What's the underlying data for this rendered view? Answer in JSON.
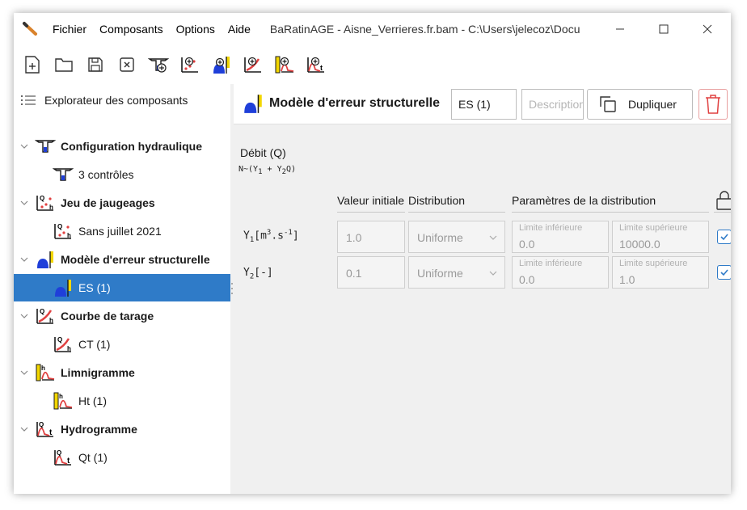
{
  "menu": [
    "Fichier",
    "Composants",
    "Options",
    "Aide"
  ],
  "window_title": "BaRatinAGE - Aisne_Verrieres.fr.bam - C:\\Users\\jelecoz\\Docum..",
  "toolbar": {
    "icons": [
      "new-file-icon",
      "open-folder-icon",
      "save-icon",
      "close-file-icon",
      "add-hydraulic-config-icon",
      "add-gauging-icon",
      "add-structural-error-icon",
      "add-rating-curve-icon",
      "add-stage-record-icon",
      "add-hydrograph-icon"
    ]
  },
  "sidebar": {
    "header": "Explorateur des composants",
    "groups": [
      {
        "label": "Configuration hydraulique",
        "child": "3 contrôles"
      },
      {
        "label": "Jeu de jaugeages",
        "child": "Sans juillet 2021"
      },
      {
        "label": "Modèle d'erreur structurelle",
        "child": "ES (1)"
      },
      {
        "label": "Courbe de tarage",
        "child": "CT (1)"
      },
      {
        "label": "Limnigramme",
        "child": "Ht (1)"
      },
      {
        "label": "Hydrogramme",
        "child": "Qt (1)"
      }
    ],
    "selected": "ES (1)"
  },
  "main": {
    "title": "Modèle d'erreur structurelle",
    "name_value": "ES (1)",
    "description_placeholder": "Description",
    "duplicate_label": "Dupliquer",
    "debit_label": "Débit (Q)",
    "formula": "N~(Y1 + Y2Q)",
    "columns": {
      "initial": "Valeur initiale",
      "distribution": "Distribution",
      "params": "Paramètres de la distribution"
    },
    "rows": [
      {
        "name": "Y1",
        "unit": "[m3.s-1]",
        "initial": "1.0",
        "distribution": "Uniforme",
        "low_label": "Limite inférieure",
        "low": "0.0",
        "high_label": "Limite supérieure",
        "high": "10000.0",
        "locked": true
      },
      {
        "name": "Y2",
        "unit": "[-]",
        "initial": "0.1",
        "distribution": "Uniforme",
        "low_label": "Limite inférieure",
        "low": "0.0",
        "high_label": "Limite supérieure",
        "high": "1.0",
        "locked": true
      }
    ]
  },
  "colors": {
    "selection": "#2f7bc8",
    "accent_red": "#e04040",
    "accent_yellow": "#f2d600",
    "icon_blue": "#1f3fd9"
  }
}
